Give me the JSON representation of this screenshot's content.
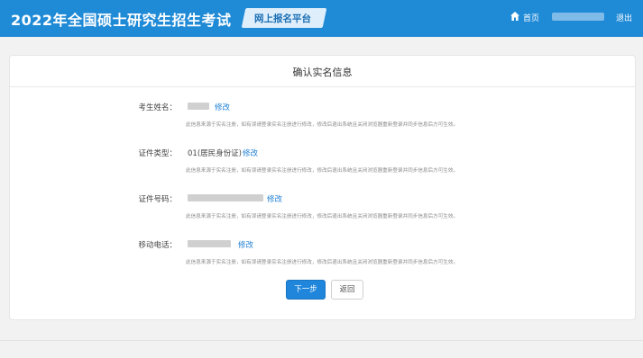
{
  "header": {
    "title": "2022年全国硕士研究生招生考试",
    "platform": "网上报名平台",
    "home_label": "首页",
    "logout_label": "退出",
    "home_icon": "home-icon"
  },
  "colors": {
    "header_bg": "#1f8ad6",
    "link": "#1f7fd4",
    "primary_button": "#1f86dc"
  },
  "card": {
    "title": "确认实名信息",
    "fields": [
      {
        "label": "考生姓名：",
        "value": "",
        "edit_label": "修改",
        "note": "此信息来源于实名注册，如有误请登录实名注册进行修改，修改后退出系统且关闭浏览器重新登录并同步信息后方可生效。"
      },
      {
        "label": "证件类型：",
        "value": "01(居民身份证)",
        "edit_label": "修改",
        "note": "此信息来源于实名注册，如有误请登录实名注册进行修改，修改后退出系统且关闭浏览器重新登录并同步信息后方可生效。"
      },
      {
        "label": "证件号码：",
        "value": "",
        "edit_label": "修改",
        "note": "此信息来源于实名注册，如有误请登录实名注册进行修改，修改后退出系统且关闭浏览器重新登录并同步信息后方可生效。"
      },
      {
        "label": "移动电话：",
        "value": "",
        "edit_label": "修改",
        "note": "此信息来源于实名注册，如有误请登录实名注册进行修改，修改后退出系统且关闭浏览器重新登录并同步信息后方可生效。"
      }
    ],
    "next_label": "下一步",
    "back_label": "返回"
  }
}
